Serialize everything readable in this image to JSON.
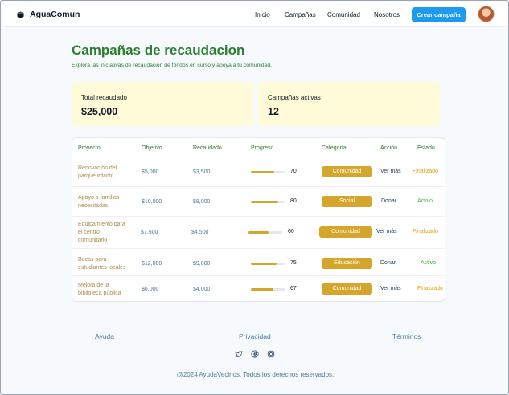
{
  "brand": {
    "name": "AguaComun"
  },
  "nav": {
    "items": [
      "Inicio",
      "Campañas",
      "Comunidad",
      "Nosotros"
    ],
    "cta_label": "Crear campaña"
  },
  "hero": {
    "title": "Campañas de recaudacion",
    "subtitle": "Explora las iniciativas de recaudación de fondos en curso y apoya a tu comunidad."
  },
  "stats": [
    {
      "label": "Total recaudado",
      "value": "$25,000"
    },
    {
      "label": "Campañas activas",
      "value": "12"
    }
  ],
  "table": {
    "headers": [
      "Proyecto",
      "Objetivo",
      "Recaudado",
      "Progreso",
      "Categoría",
      "Acción",
      "Estado"
    ],
    "rows": [
      {
        "project_lines": [
          "Renovación del",
          "parque infantil"
        ],
        "goal": "$5,000",
        "raised": "$3,500",
        "progress": 70,
        "progress_label": "70",
        "category": "Comunidad",
        "action": "Ver más",
        "status": "Finalizado",
        "status_type": "done"
      },
      {
        "project_lines": [
          "Apoyo a familias",
          "necesitadas"
        ],
        "goal": "$10,000",
        "raised": "$8,000",
        "progress": 80,
        "progress_label": "80",
        "category": "Social",
        "action": "Donar",
        "status": "Activo",
        "status_type": "active"
      },
      {
        "project_lines": [
          "Equipamiento para",
          "el centro",
          "comunitario"
        ],
        "goal": "$7,500",
        "raised": "$4,500",
        "progress": 60,
        "progress_label": "60",
        "category": "Comunidad",
        "action": "Ver más",
        "status": "Finalizado",
        "status_type": "done"
      },
      {
        "project_lines": [
          "Becas para",
          "estudiantes locales"
        ],
        "goal": "$12,000",
        "raised": "$9,000",
        "progress": 75,
        "progress_label": "75",
        "category": "Educación",
        "action": "Donar",
        "status": "Activo",
        "status_type": "active"
      },
      {
        "project_lines": [
          "Mejora de la",
          "biblioteca pública"
        ],
        "goal": "$6,000",
        "raised": "$4,000",
        "progress": 67,
        "progress_label": "67",
        "category": "Comunidad",
        "action": "Ver más",
        "status": "Finalizado",
        "status_type": "done"
      }
    ]
  },
  "footer": {
    "links": [
      "Ayuda",
      "Privacidad",
      "Términos"
    ],
    "social_icons": [
      "twitter-icon",
      "facebook-icon",
      "instagram-icon"
    ],
    "copyright": "@2024 AyudaVecinos. Todos los derechos reservados."
  },
  "colors": {
    "accent_green": "#2e7d32",
    "primary_blue": "#1d9bf0",
    "badge_gold": "#d4a72c",
    "stat_card_bg": "#fffbd9",
    "status_done": "#e5a00d",
    "status_active": "#4caf50"
  }
}
